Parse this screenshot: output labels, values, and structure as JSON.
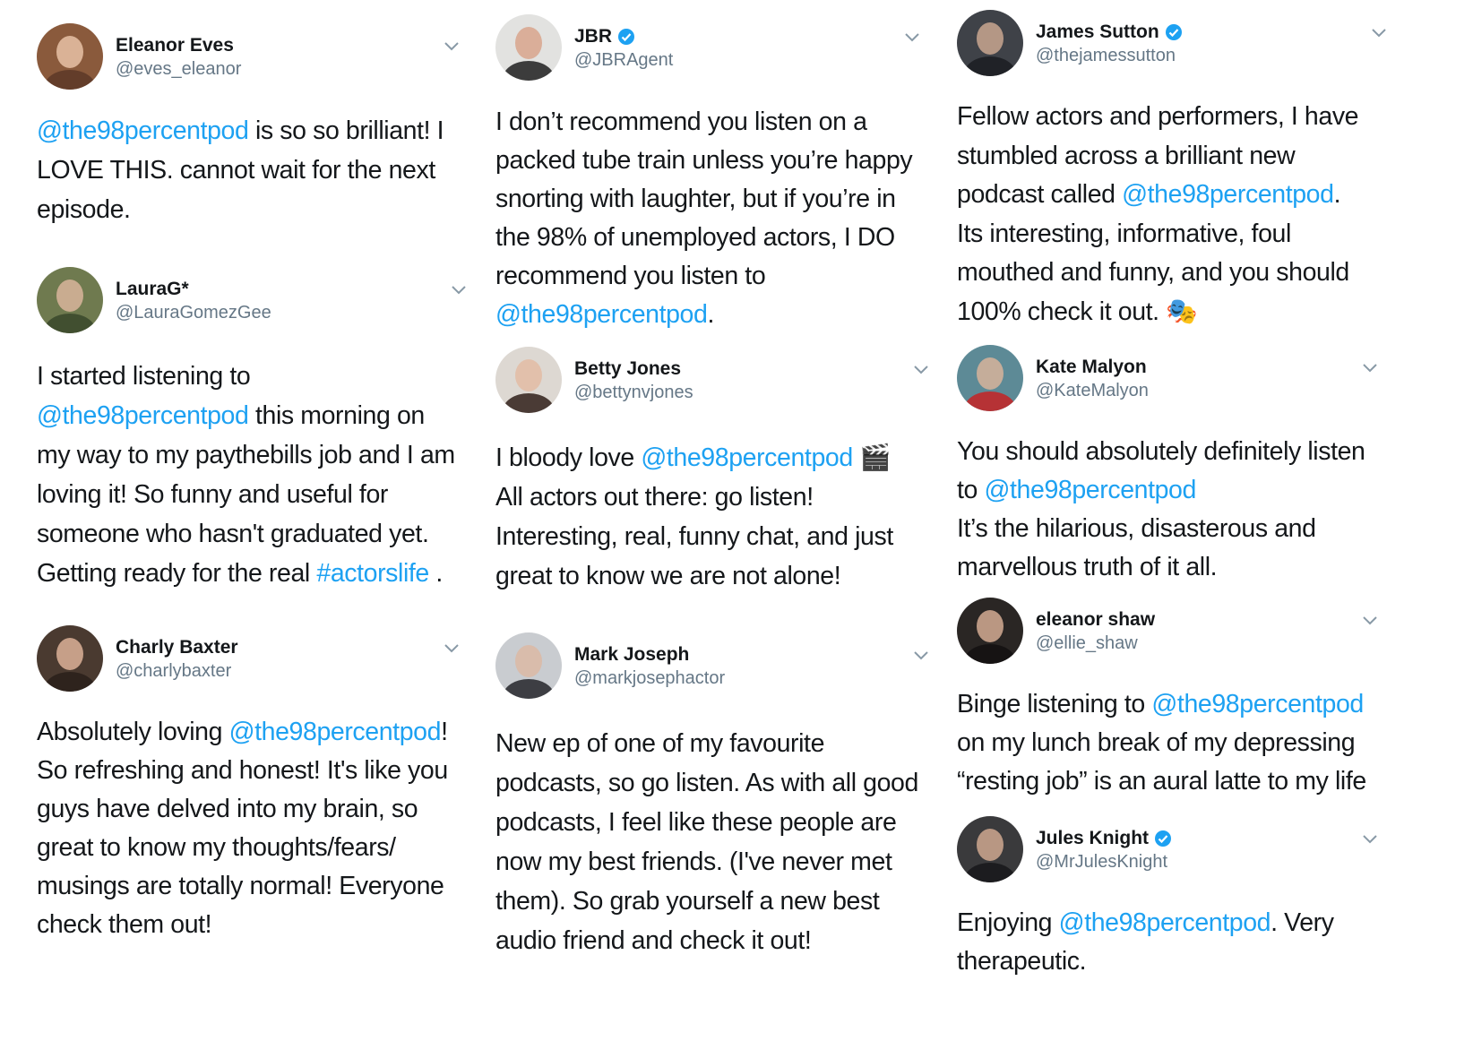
{
  "colors": {
    "link": "#1da1f2",
    "text": "#14171a",
    "handle": "#657786",
    "verified": "#1da1f2"
  },
  "tweets": {
    "eleanor_eves": {
      "name": "Eleanor Eves",
      "handle": "@eves_eleanor",
      "verified": false,
      "parts": [
        "",
        "@the98percentpod",
        " is so so brilliant! I\nLOVE THIS. cannot wait for the next\nepisode."
      ]
    },
    "lauragee": {
      "name": "LauraG*",
      "handle": "@LauraGomezGee",
      "verified": false,
      "parts": [
        "I started listening to\n",
        "@the98percentpod",
        " this morning on\nmy way to my paythebills job and I am\nloving it! So funny and useful for\nsomeone who hasn't graduated yet.\nGetting ready for the real ",
        "#actorslife",
        " ."
      ]
    },
    "charly_baxter": {
      "name": "Charly Baxter",
      "handle": "@charlybaxter",
      "verified": false,
      "parts": [
        "Absolutely loving ",
        "@the98percentpod",
        "!\nSo refreshing and honest! It's like you\nguys have delved into my brain, so\ngreat to know my thoughts/fears/\nmusings are totally normal! Everyone\ncheck them out!"
      ]
    },
    "jbr": {
      "name": "JBR",
      "handle": "@JBRAgent",
      "verified": true,
      "parts": [
        "I don’t recommend you listen on a\npacked tube train unless you’re happy\nsnorting with laughter, but if you’re in\nthe 98% of unemployed actors, I DO\nrecommend you listen to\n",
        "@the98percentpod",
        "."
      ]
    },
    "betty_jones": {
      "name": "Betty Jones",
      "handle": "@bettynvjones",
      "verified": false,
      "parts": [
        "I bloody love ",
        "@the98percentpod",
        " 🎬\nAll actors out there: go listen!\nInteresting, real, funny chat, and just\ngreat to know we are not alone!"
      ]
    },
    "mark_joseph": {
      "name": "Mark Joseph",
      "handle": "@markjosephactor",
      "verified": false,
      "parts": [
        "New ep of one of my favourite\npodcasts, so go listen. As with all good\npodcasts, I feel like these people are\nnow my best friends. (I've never met\nthem). So grab yourself a new best\naudio friend and check it out!"
      ]
    },
    "james_sutton": {
      "name": "James Sutton",
      "handle": "@thejamessutton",
      "verified": true,
      "parts": [
        "Fellow actors and performers, I have\nstumbled across a brilliant new\npodcast called ",
        "@the98percentpod",
        ".\nIts interesting, informative, foul\nmouthed and funny, and you should\n100% check it out. 🎭"
      ]
    },
    "kate_malyon": {
      "name": "Kate Malyon",
      "handle": "@KateMalyon",
      "verified": false,
      "parts": [
        "You should absolutely definitely listen\nto ",
        "@the98percentpod",
        "\nIt’s the hilarious, disasterous and\nmarvellous truth of it all."
      ]
    },
    "eleanor_shaw": {
      "name": "eleanor shaw",
      "handle": "@ellie_shaw",
      "verified": false,
      "parts": [
        "Binge listening to ",
        "@the98percentpod",
        "\non my lunch break of my depressing\n“resting job” is an aural latte to my life"
      ]
    },
    "jules_knight": {
      "name": "Jules Knight",
      "handle": "@MrJulesKnight",
      "verified": true,
      "parts": [
        "Enjoying ",
        "@the98percentpod",
        ". Very\ntherapeutic."
      ]
    }
  }
}
